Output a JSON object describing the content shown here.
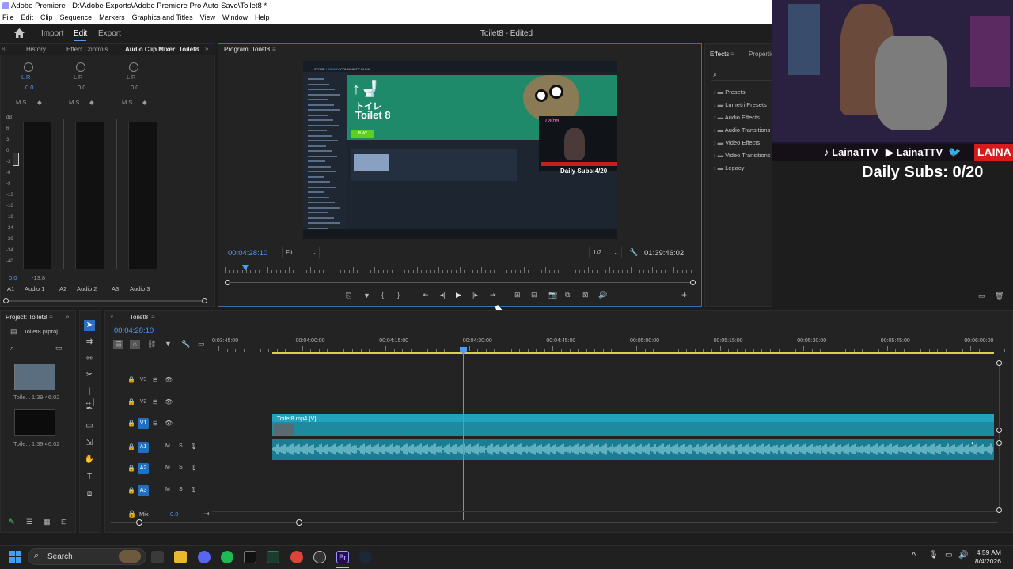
{
  "window": {
    "title": "Adobe Premiere - D:\\Adobe Exports\\Adobe Premiere Pro Auto-Save\\Toilet8 *"
  },
  "menu": [
    "File",
    "Edit",
    "Clip",
    "Sequence",
    "Markers",
    "Graphics and Titles",
    "View",
    "Window",
    "Help"
  ],
  "workspace": {
    "tabs": [
      "Import",
      "Edit",
      "Export"
    ],
    "active": "Edit",
    "doc_title": "Toilet8 - Edited"
  },
  "left_panel": {
    "tabs": [
      "History",
      "Effect Controls",
      "Audio Clip Mixer: Toilet8"
    ],
    "lr": "L    R",
    "vals": [
      "0.0",
      "0.0",
      "0.0"
    ],
    "msr": "M  S",
    "scale": [
      "dB",
      "6",
      "3",
      "0",
      "-3",
      "-6",
      "-9",
      "-13",
      "-16",
      "-19",
      "-24",
      "-29",
      "-34",
      "-40"
    ],
    "bottom_vals": [
      "0.0",
      "-13.8"
    ],
    "channels": [
      {
        "id": "A1",
        "name": "Audio 1"
      },
      {
        "id": "A2",
        "name": "Audio 2"
      },
      {
        "id": "A3",
        "name": "Audio 3"
      }
    ]
  },
  "program": {
    "title": "Program: Toilet8",
    "timecode": "00:04:28:10",
    "fit": "Fit",
    "res": "1/2",
    "duration": "01:39:46:02",
    "preview": {
      "game_title": "Toilet 8",
      "jp_text": "トイレ",
      "play": "PLAY",
      "overlay_sub": "Daily Subs:4/20",
      "store_tabs": [
        "STORE",
        "LIBRARY",
        "COMMUNITY",
        "LAINA"
      ]
    }
  },
  "effects": {
    "tabs": [
      "Effects",
      "Properties"
    ],
    "items": [
      "Presets",
      "Lumetri Presets",
      "Audio Effects",
      "Audio Transitions",
      "Video Effects",
      "Video Transitions",
      "Legacy"
    ]
  },
  "webcam": {
    "social_handle_1": "LainaTTV",
    "social_handle_2": "LainaTTV",
    "social_name": "LAINA",
    "daily_subs": "Daily Subs: 0/20"
  },
  "project": {
    "title": "Project: Toilet8",
    "file": "Toilet8.prproj",
    "items": [
      {
        "name": "Toile...",
        "dur": "1:39:46:02"
      },
      {
        "name": "Toile...",
        "dur": "1:39:46:02"
      }
    ]
  },
  "timeline": {
    "tab": "Toilet8",
    "timecode": "00:04:28:10",
    "ruler": [
      "0:03:45:00",
      "00:04:00:00",
      "00:04:15:00",
      "00:04:30:00",
      "00:04:45:00",
      "00:05:00:00",
      "00:05:15:00",
      "00:05:30:00",
      "00:05:45:00",
      "00:06:00:00"
    ],
    "video_tracks": [
      "V3",
      "V2",
      "V1"
    ],
    "audio_tracks": [
      "A1",
      "A2",
      "A3"
    ],
    "mix_label": "Mix",
    "mix_value": "0.0",
    "clip_label": "Toilet8.mp4 [V]"
  },
  "taskbar": {
    "search": "Search",
    "time": "4:59 AM",
    "date": "8/4/2026"
  },
  "colors": {
    "accent": "#4d9bf5",
    "clip_teal": "#1e8aa0",
    "track_blue": "#1f6fc3"
  }
}
